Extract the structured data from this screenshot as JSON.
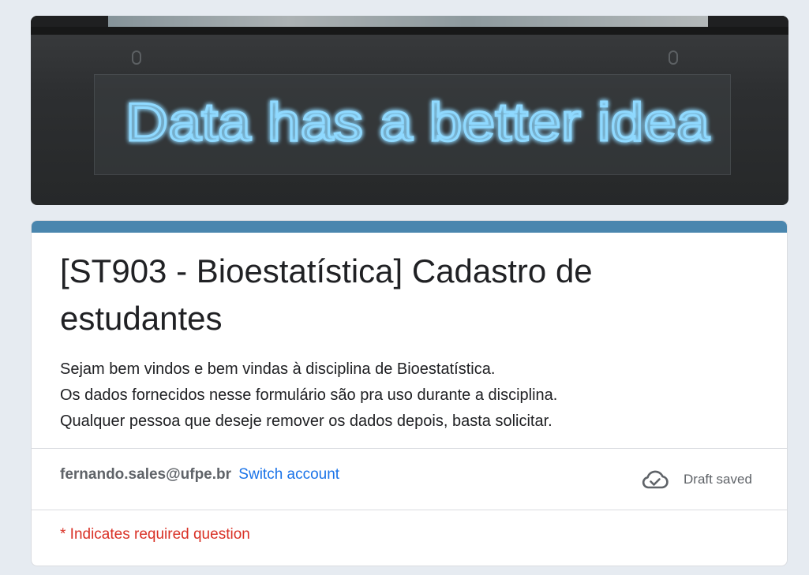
{
  "banner": {
    "neon_text": "Data has a better idea",
    "neon_color": "#8fd9ff"
  },
  "form": {
    "title": "[ST903 - Bioestatística] Cadastro de estudantes",
    "description_lines": [
      "Sejam bem vindos e bem vindas à disciplina de Bioestatística.",
      "Os dados fornecidos nesse formulário são pra uso durante a disciplina.",
      "Qualquer pessoa que deseje remover os dados depois, basta solicitar."
    ],
    "accent_color": "#4a86ae"
  },
  "account": {
    "email": "fernando.sales@ufpe.br",
    "switch_label": "Switch account",
    "status_icon": "cloud-done-icon",
    "status_text": "Draft saved"
  },
  "required_note": "* Indicates required question"
}
